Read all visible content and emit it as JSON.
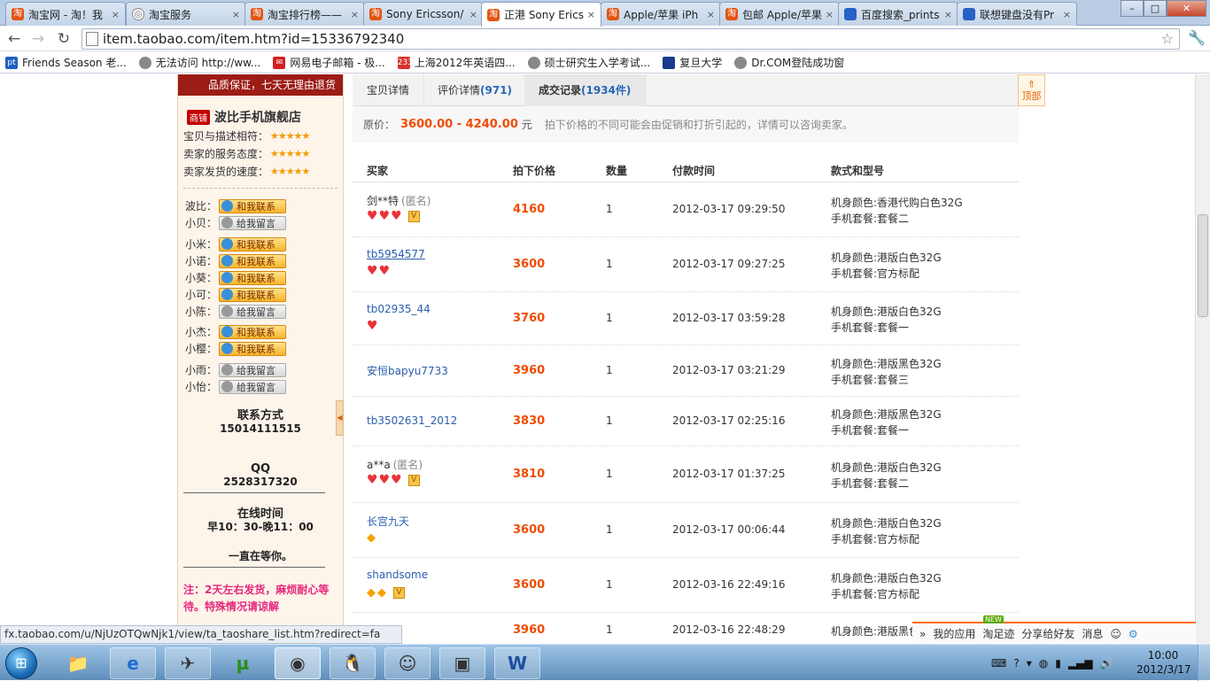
{
  "browser": {
    "tabs": [
      {
        "title": "淘宝网 - 淘！我",
        "icon": "taobao-icon"
      },
      {
        "title": "淘宝服务",
        "icon": "globe-icon"
      },
      {
        "title": "淘宝排行榜——",
        "icon": "taobao-icon"
      },
      {
        "title": "Sony Ericsson/",
        "icon": "taobao-icon"
      },
      {
        "title": "正港 Sony Erics",
        "icon": "taobao-icon",
        "active": true
      },
      {
        "title": "Apple/苹果 iPh",
        "icon": "taobao-icon"
      },
      {
        "title": "包邮 Apple/苹果",
        "icon": "taobao-icon"
      },
      {
        "title": "百度搜索_prints",
        "icon": "baidu-paw-icon"
      },
      {
        "title": "联想键盘没有Pr",
        "icon": "baidu-paw-icon"
      }
    ],
    "tab_close": "×",
    "window_buttons": {
      "minimize": "–",
      "maximize": "□",
      "close": "✕"
    },
    "url": "item.taobao.com/item.htm?id=15336792340",
    "bookmarks": [
      {
        "label": "Friends Season 老...",
        "icon": "pt-icon",
        "icon_text": "pt",
        "color": "#2060c0"
      },
      {
        "label": "无法访问 http://ww...",
        "icon": "globe-icon",
        "icon_text": "",
        "color": "#888888"
      },
      {
        "label": "网易电子邮箱 - 极...",
        "icon": "netease-icon",
        "icon_text": "✉",
        "color": "#d02020"
      },
      {
        "label": "上海2012年英语四...",
        "icon": "calendar-icon",
        "icon_text": "233",
        "color": "#d8322a"
      },
      {
        "label": "硕士研究生入学考试...",
        "icon": "globe-icon",
        "icon_text": "",
        "color": "#888888"
      },
      {
        "label": "复旦大学",
        "icon": "fudan-icon",
        "icon_text": "",
        "color": "#1a3b8c"
      },
      {
        "label": "Dr.COM登陆成功窗",
        "icon": "globe-icon",
        "icon_text": "",
        "color": "#888888"
      }
    ],
    "status_url": "fx.taobao.com/u/NjUzOTQwNjk1/view/ta_taoshare_list.htm?redirect=fa"
  },
  "sidebar": {
    "guarantee": "品质保证，七天无理由退货",
    "mall_badge": "商铺",
    "shop_name": "波比手机旗舰店",
    "ratings": [
      {
        "label": "宝贝与描述相符：",
        "stars": "★★★★★"
      },
      {
        "label": "卖家的服务态度：",
        "stars": "★★★★★"
      },
      {
        "label": "卖家发货的速度：",
        "stars": "★★★★★"
      }
    ],
    "agents": [
      {
        "name": "波比：",
        "button": "和我联系",
        "online": true
      },
      {
        "name": "小贝：",
        "button": "给我留言",
        "online": false
      },
      {
        "name": "小米：",
        "button": "和我联系",
        "online": true
      },
      {
        "name": "小诺：",
        "button": "和我联系",
        "online": true
      },
      {
        "name": "小葵：",
        "button": "和我联系",
        "online": true
      },
      {
        "name": "小可：",
        "button": "和我联系",
        "online": true
      },
      {
        "name": "小陈：",
        "button": "给我留言",
        "online": false
      },
      {
        "name": "小杰：",
        "button": "和我联系",
        "online": true
      },
      {
        "name": "小樱：",
        "button": "和我联系",
        "online": true
      },
      {
        "name": "小雨：",
        "button": "给我留言",
        "online": false
      },
      {
        "name": "小怡：",
        "button": "给我留言",
        "online": false
      }
    ],
    "contact_label": "联系方式",
    "contact_value": "15014111515",
    "qq_label": "QQ",
    "qq_value": "2528317320",
    "online_label": "在线时间",
    "online_value": "早10：30-晚11：00",
    "waiting": "一直在等你。",
    "notice": "注：2天左右发货，麻烦耐心等待。特殊情况请谅解"
  },
  "detail": {
    "tabs": [
      {
        "label": "宝贝详情",
        "count": ""
      },
      {
        "label": "评价详情",
        "count": "(971)"
      },
      {
        "label": "成交记录",
        "count": "(1934件)",
        "active": true
      }
    ],
    "to_top": "顶部",
    "price_label": "原价：",
    "price_value": "3600.00 - 4240.00",
    "price_unit": "元",
    "price_note": "拍下价格的不同可能会由促销和打折引起的，详情可以咨询卖家。",
    "columns": [
      "买家",
      "拍下价格",
      "数量",
      "付款时间",
      "款式和型号"
    ],
    "records": [
      {
        "buyer": "剑**特",
        "anon": "(匿名)",
        "link": false,
        "hearts": 3,
        "diamonds": 0,
        "vip": true,
        "price": "4160",
        "qty": "1",
        "time": "2012-03-17 09:29:50",
        "sku1": "机身颜色:香港代购白色32G",
        "sku2": "手机套餐:套餐二"
      },
      {
        "buyer": "tb5954577",
        "anon": "",
        "link": true,
        "hearts": 2,
        "diamonds": 0,
        "vip": false,
        "price": "3600",
        "qty": "1",
        "time": "2012-03-17 09:27:25",
        "sku1": "机身颜色:港版白色32G",
        "sku2": "手机套餐:官方标配"
      },
      {
        "buyer": "tb02935_44",
        "anon": "",
        "link": false,
        "hearts": 1,
        "diamonds": 0,
        "vip": false,
        "price": "3760",
        "qty": "1",
        "time": "2012-03-17 03:59:28",
        "sku1": "机身颜色:港版白色32G",
        "sku2": "手机套餐:套餐一"
      },
      {
        "buyer": "安恒bapyu7733",
        "anon": "",
        "link": false,
        "hearts": 0,
        "diamonds": 0,
        "vip": false,
        "price": "3960",
        "qty": "1",
        "time": "2012-03-17 03:21:29",
        "sku1": "机身颜色:港版黑色32G",
        "sku2": "手机套餐:套餐三"
      },
      {
        "buyer": "tb3502631_2012",
        "anon": "",
        "link": false,
        "hearts": 0,
        "diamonds": 0,
        "vip": false,
        "price": "3830",
        "qty": "1",
        "time": "2012-03-17 02:25:16",
        "sku1": "机身颜色:港版黑色32G",
        "sku2": "手机套餐:套餐一"
      },
      {
        "buyer": "a**a",
        "anon": "(匿名)",
        "link": false,
        "hearts": 3,
        "diamonds": 0,
        "vip": true,
        "price": "3810",
        "qty": "1",
        "time": "2012-03-17 01:37:25",
        "sku1": "机身颜色:港版白色32G",
        "sku2": "手机套餐:套餐二"
      },
      {
        "buyer": "长宫九天",
        "anon": "",
        "link": false,
        "hearts": 0,
        "diamonds": 1,
        "vip": false,
        "price": "3600",
        "qty": "1",
        "time": "2012-03-17 00:06:44",
        "sku1": "机身颜色:港版白色32G",
        "sku2": "手机套餐:官方标配"
      },
      {
        "buyer": "shandsome",
        "anon": "",
        "link": false,
        "hearts": 0,
        "diamonds": 2,
        "vip": true,
        "price": "3600",
        "qty": "1",
        "time": "2012-03-16 22:49:16",
        "sku1": "机身颜色:港版白色32G",
        "sku2": "手机套餐:官方标配"
      },
      {
        "buyer": "",
        "anon": "",
        "link": false,
        "hearts": 0,
        "diamonds": 0,
        "vip": false,
        "price": "3960",
        "qty": "1",
        "time": "2012-03-16 22:48:29",
        "sku1": "机身颜色:港版黑色",
        "sku2": ""
      }
    ]
  },
  "bottombar": {
    "apps": "我的应用",
    "new_badge": "NEW",
    "footprint": "淘足迹",
    "share": "分享给好友",
    "messages": "消息"
  },
  "taskbar": {
    "start": "⊞",
    "apps": [
      {
        "name": "file-explorer-icon",
        "glyph": "📁"
      },
      {
        "name": "internet-explorer-icon",
        "glyph": "e"
      },
      {
        "name": "feiq-icon",
        "glyph": "✈"
      },
      {
        "name": "utorrent-icon",
        "glyph": "µ"
      },
      {
        "name": "chrome-icon",
        "glyph": "◉"
      },
      {
        "name": "qq-icon",
        "glyph": "🐧"
      },
      {
        "name": "aliwangwang-icon",
        "glyph": "☺"
      },
      {
        "name": "monitor-app-icon",
        "glyph": "▣"
      },
      {
        "name": "word-icon",
        "glyph": "W"
      }
    ],
    "time": "10:00",
    "date": "2012/3/17"
  },
  "colors": {
    "price_orange": "#f04c00",
    "accent_brand": "#9c1c16",
    "link_blue": "#2b5dad"
  }
}
